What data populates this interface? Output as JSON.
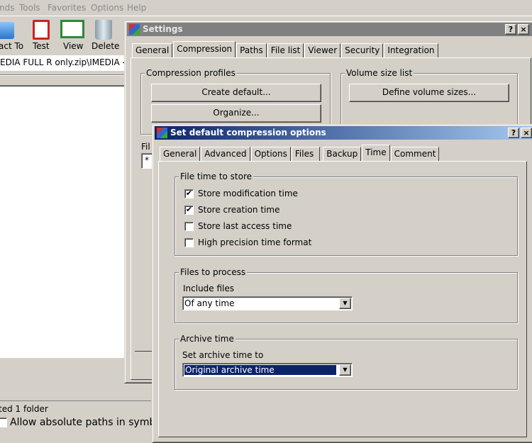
{
  "menu": [
    "nds",
    "Tools",
    "Favorites",
    "Options",
    "Help"
  ],
  "toolbar": [
    {
      "label": "act To",
      "icon": "extract-folder-icon"
    },
    {
      "label": "Test",
      "icon": "test-clipboard-icon"
    },
    {
      "label": "View",
      "icon": "book-icon"
    },
    {
      "label": "Delete",
      "icon": "trash-icon"
    }
  ],
  "address": "EDIA FULL R only.zip\\IMEDIA - ALI",
  "status": "ted 1 folder",
  "absolute_paths_label": "Allow absolute paths in symb",
  "settings": {
    "title": "Settings",
    "help": "?",
    "close": "×",
    "tabs": [
      "General",
      "Compression",
      "Paths",
      "File list",
      "Viewer",
      "Security",
      "Integration"
    ],
    "active_tab": "Compression",
    "profiles_label": "Compression profiles",
    "create_default": "Create default...",
    "organize": "Organize...",
    "volume_label": "Volume size list",
    "define_volume": "Define volume sizes...",
    "files_label": "Fil",
    "files_value": "*"
  },
  "dialog": {
    "title": "Set default compression options",
    "help": "?",
    "close": "×",
    "tabs": [
      "General",
      "Advanced",
      "Options",
      "Files",
      "Backup",
      "Time",
      "Comment"
    ],
    "active_tab": "Time",
    "file_time_label": "File time to store",
    "checkboxes": [
      {
        "label": "Store modification time",
        "checked": true
      },
      {
        "label": "Store creation time",
        "checked": true
      },
      {
        "label": "Store last access time",
        "checked": false
      },
      {
        "label": "High precision time format",
        "checked": false
      }
    ],
    "files_to_process_label": "Files to process",
    "include_files_label": "Include files",
    "include_files_value": "Of any time",
    "archive_time_label": "Archive time",
    "set_archive_time_label": "Set archive time to",
    "archive_time_value": "Original archive time"
  },
  "colors": {
    "active_title": "#0a246a",
    "inactive_title": "#808080",
    "selection": "#0a246a"
  }
}
